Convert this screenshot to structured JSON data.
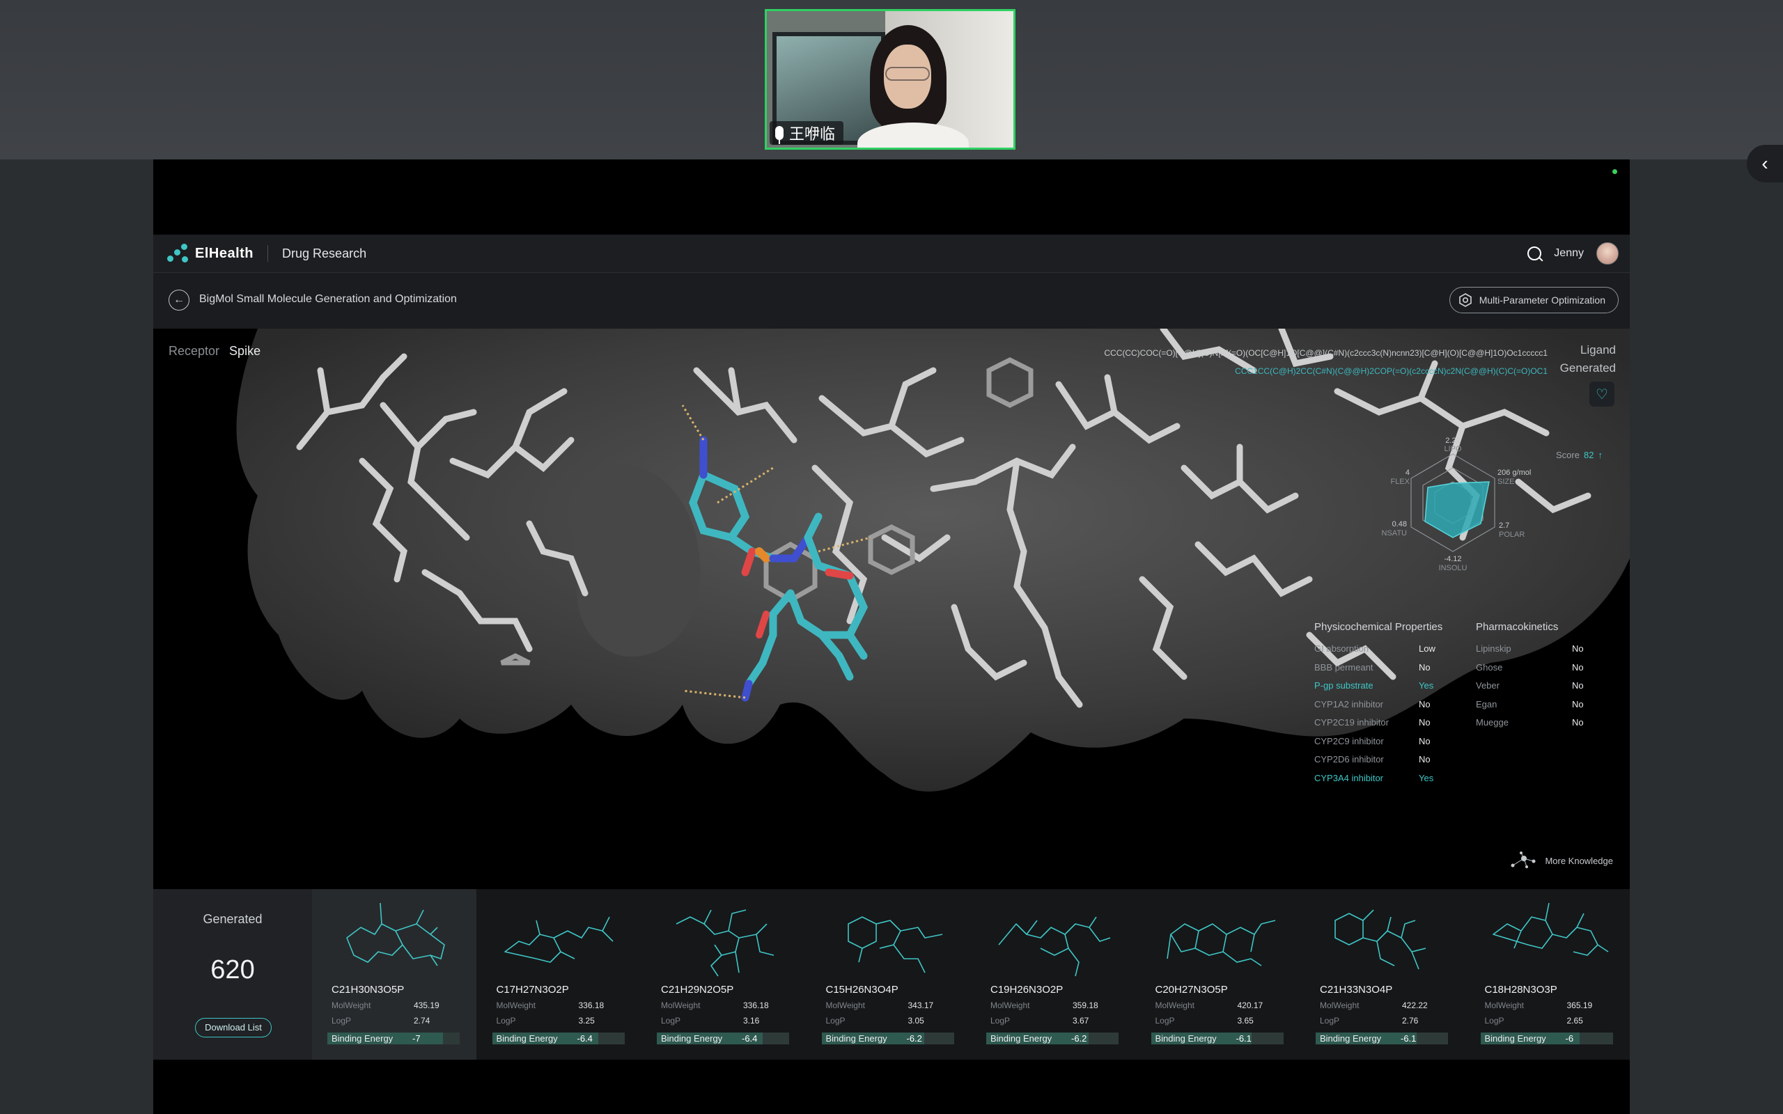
{
  "meeting": {
    "participant_name": "王咿临"
  },
  "app": {
    "brand": "ElHealth",
    "section": "Drug Research",
    "user_name": "Jenny",
    "page_title": "BigMol Small Molecule Generation and Optimization",
    "mpo_button": "Multi-Parameter Optimization"
  },
  "viewer": {
    "receptor_label": "Receptor",
    "receptor_value": "Spike",
    "smiles_ligand": "CCC(CC)COC(=O)[C@H](C)N[P](=O)(OC[C@H]1O[C@@](C#N)(c2ccc3c(N)ncnn23)[C@H](O)[C@@H]1O)Oc1ccccc1",
    "smiles_generated": "CCC1CC(C@H)2CC(C#N)(C@@H)2COP(=O)(c2ccccN)c2N(C@@H)(C)C(=O)OC1",
    "ligand_label": "Ligand",
    "generated_label": "Generated",
    "more_knowledge": "More Knowledge"
  },
  "radar": {
    "score_label": "Score",
    "score_value": "82",
    "axes": [
      {
        "name": "LIPO",
        "value": "2.21"
      },
      {
        "name": "SIZE",
        "value": "206 g/mol"
      },
      {
        "name": "POLAR",
        "value": "2.7"
      },
      {
        "name": "INSOLU",
        "value": "-4.12"
      },
      {
        "name": "NSATU",
        "value": "0.48"
      },
      {
        "name": "FLEX",
        "value": "4"
      }
    ]
  },
  "physchem": {
    "title": "Physicochemical Properties",
    "rows": [
      {
        "k": "GI absorption",
        "v": "Low"
      },
      {
        "k": "BBB permeant",
        "v": "No"
      },
      {
        "k": "P-gp substrate",
        "v": "Yes"
      },
      {
        "k": "CYP1A2 inhibitor",
        "v": "No"
      },
      {
        "k": "CYP2C19 inhibitor",
        "v": "No"
      },
      {
        "k": "CYP2C9 inhibitor",
        "v": "No"
      },
      {
        "k": "CYP2D6 inhibitor",
        "v": "No"
      },
      {
        "k": "CYP3A4 inhibitor",
        "v": "Yes"
      }
    ]
  },
  "pharmacokinetics": {
    "title": "Pharmacokinetics",
    "rows": [
      {
        "k": "Lipinskip",
        "v": "No"
      },
      {
        "k": "Ghose",
        "v": "No"
      },
      {
        "k": "Veber",
        "v": "No"
      },
      {
        "k": "Egan",
        "v": "No"
      },
      {
        "k": "Muegge",
        "v": "No"
      }
    ]
  },
  "generated": {
    "title": "Generated",
    "count": "620",
    "download_label": "Download List",
    "mw_label": "MolWeight",
    "logp_label": "LogP",
    "be_label": "Binding Energy",
    "molecules": [
      {
        "formula": "C21H30N3O5P",
        "molweight": "435.19",
        "logp": "2.74",
        "binding_energy": "-7"
      },
      {
        "formula": "C17H27N3O2P",
        "molweight": "336.18",
        "logp": "3.25",
        "binding_energy": "-6.4"
      },
      {
        "formula": "C21H29N2O5P",
        "molweight": "336.18",
        "logp": "3.16",
        "binding_energy": "-6.4"
      },
      {
        "formula": "C15H26N3O4P",
        "molweight": "343.17",
        "logp": "3.05",
        "binding_energy": "-6.2"
      },
      {
        "formula": "C19H26N3O2P",
        "molweight": "359.18",
        "logp": "3.67",
        "binding_energy": "-6.2"
      },
      {
        "formula": "C20H27N3O5P",
        "molweight": "420.17",
        "logp": "3.65",
        "binding_energy": "-6.1"
      },
      {
        "formula": "C21H33N3O4P",
        "molweight": "422.22",
        "logp": "2.76",
        "binding_energy": "-6.1"
      },
      {
        "formula": "C18H28N3O3P",
        "molweight": "365.19",
        "logp": "2.65",
        "binding_energy": "-6"
      }
    ]
  },
  "colors": {
    "accent": "#3fc6c6",
    "meeting_border": "#2fd163",
    "app_bg": "#000000",
    "panel_bg": "#1c1e21"
  }
}
